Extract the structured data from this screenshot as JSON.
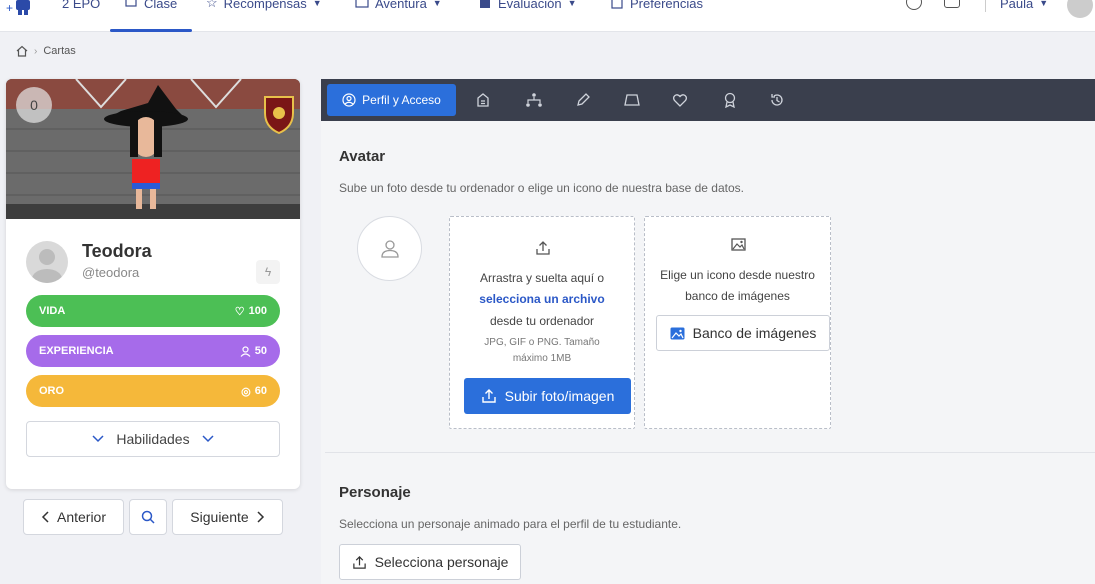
{
  "topnav": {
    "items": [
      {
        "label": "2 EPO",
        "icon": "users-icon"
      },
      {
        "label": "Clase",
        "icon": "class-icon"
      },
      {
        "label": "Recompensas",
        "icon": "star-icon"
      },
      {
        "label": "Aventura",
        "icon": "map-icon"
      },
      {
        "label": "Evaluación",
        "icon": "building-icon"
      },
      {
        "label": "Preferencias",
        "icon": "settings-icon"
      }
    ],
    "user_name": "Paula"
  },
  "breadcrumb": {
    "current": "Cartas"
  },
  "student": {
    "score": "0",
    "name": "Teodora",
    "handle": "@teodora",
    "stats": {
      "vida": {
        "label": "VIDA",
        "value": "100"
      },
      "experiencia": {
        "label": "EXPERIENCIA",
        "value": "50"
      },
      "oro": {
        "label": "ORO",
        "value": "60"
      }
    },
    "skills_label": "Habilidades"
  },
  "pager": {
    "prev": "Anterior",
    "next": "Siguiente"
  },
  "toolbar": {
    "active_tab": "Perfil y Acceso"
  },
  "avatar_section": {
    "title": "Avatar",
    "desc": "Sube un foto desde tu ordenador o elige un icono de nuestra base de datos.",
    "upload": {
      "line1": "Arrastra y suelta aquí o",
      "link": "selecciona un archivo",
      "line3": "desde tu ordenador",
      "hint1": "JPG, GIF o PNG. Tamaño",
      "hint2": "máximo 1MB",
      "button": "Subir foto/imagen"
    },
    "bank": {
      "line1": "Elige un icono desde nuestro",
      "line2": "banco de imágenes",
      "button": "Banco de imágenes"
    }
  },
  "character_section": {
    "title": "Personaje",
    "desc": "Selecciona un personaje animado para el perfil de tu estudiante.",
    "button": "Selecciona personaje"
  },
  "colors": {
    "primary": "#2b6fdb",
    "toolbar": "#3a3f4d",
    "vida": "#4cbf55",
    "experiencia": "#a66bea",
    "oro": "#f5b83a"
  }
}
